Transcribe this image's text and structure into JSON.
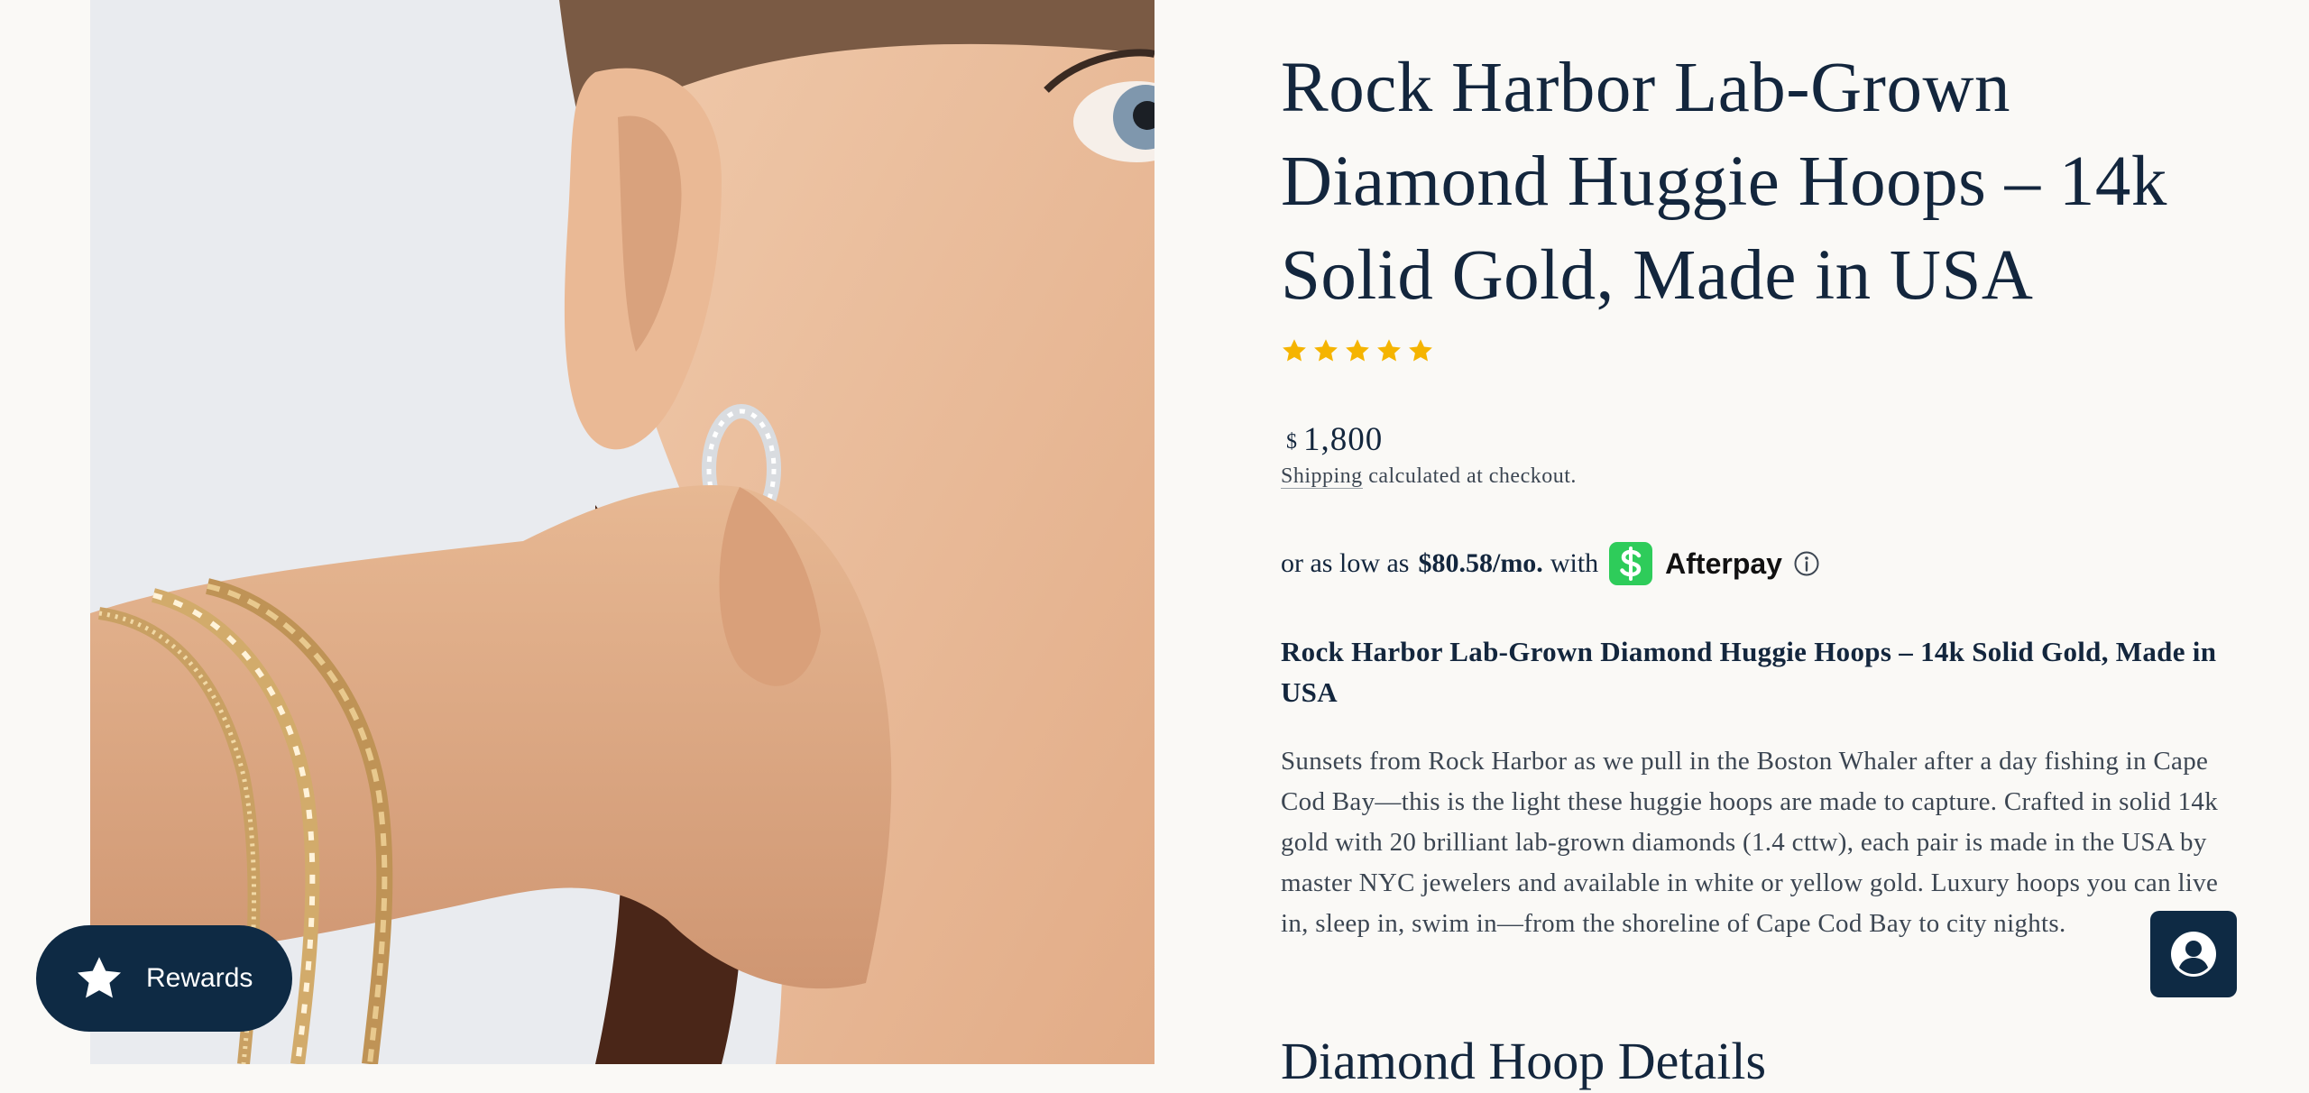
{
  "product": {
    "title": "Rock Harbor Lab-Grown Diamond Huggie Hoops – 14k Solid Gold, Made in USA",
    "rating_stars": 5,
    "rating_color": "#f5b400",
    "price_currency": "$",
    "price_amount": "1,800",
    "shipping_link": "Shipping",
    "shipping_rest": " calculated at checkout."
  },
  "afterpay": {
    "prefix": "or as low as",
    "amount": "$80.58/mo.",
    "with": "with",
    "brand": "Afterpay",
    "badge_color": "#2ecc5a"
  },
  "description": {
    "title": "Rock Harbor Lab-Grown Diamond Huggie Hoops – 14k Solid Gold, Made in USA",
    "body": "Sunsets from Rock Harbor as we pull in the Boston Whaler after a day fishing in Cape Cod Bay—this is the light these huggie hoops are made to capture. Crafted in solid 14k gold with 20 brilliant lab-grown diamonds (1.4 cttw), each pair is made in the USA by master NYC jewelers and available in white or yellow gold. Luxury hoops you can live in, sleep in, swim in—from the shoreline of Cape Cod Bay to city nights."
  },
  "details_heading": "Diamond Hoop Details",
  "widgets": {
    "rewards_label": "Rewards",
    "brand_color": "#0e2a44"
  },
  "icons": {
    "rating": "star-icon",
    "afterpay_badge": "dollar-icon",
    "afterpay_info": "info-icon",
    "rewards": "star-icon",
    "account": "user-icon"
  }
}
